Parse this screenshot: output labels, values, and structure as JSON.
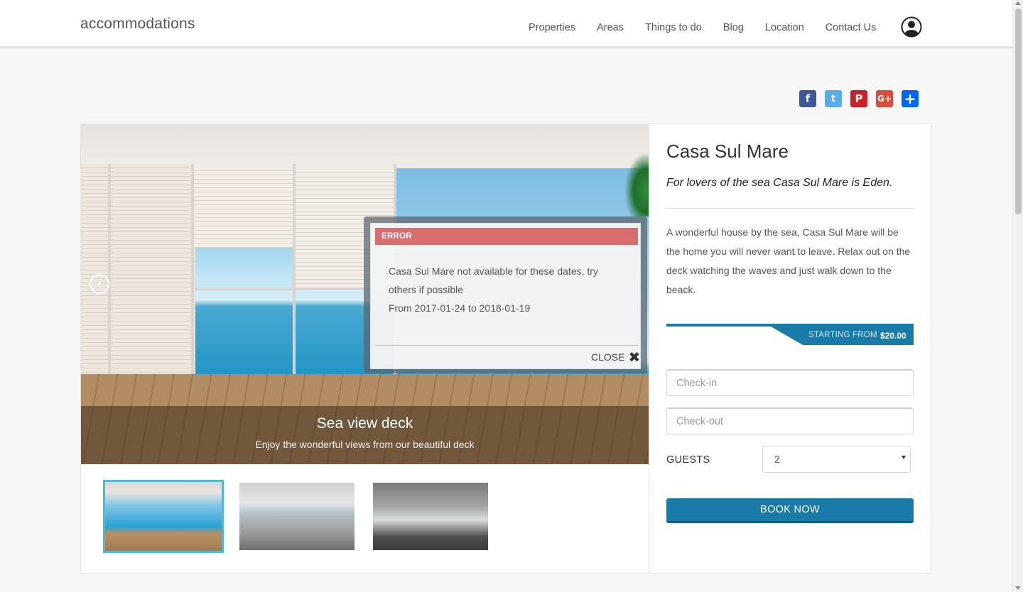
{
  "header": {
    "logo": "accommodations",
    "nav": [
      "Properties",
      "Areas",
      "Things to do",
      "Blog",
      "Location",
      "Contact Us"
    ],
    "user_icon": "user-circle-icon"
  },
  "share": {
    "icons": [
      "facebook-icon",
      "twitter-icon",
      "pinterest-icon",
      "google-plus-icon",
      "share-icon"
    ],
    "facebook": "f",
    "twitter": "t",
    "pinterest": "P",
    "google": "G+",
    "share": "+",
    "colors": {
      "facebook": "#3b5998",
      "twitter": "#55acee",
      "pinterest": "#cb2027",
      "google": "#dd4b39",
      "share": "#0166ff"
    }
  },
  "gallery": {
    "caption_title": "Sea view deck",
    "caption_subtitle": "Enjoy the wonderful views from our beautiful deck",
    "prev_arrow": "‹",
    "next_arrow": "›",
    "thumbnails": [
      "thumb-1",
      "thumb-2",
      "thumb-3"
    ],
    "active_thumbnail": 1
  },
  "error_modal": {
    "heading": "ERROR",
    "message": "Casa Sul Mare not available for these dates, try others if possible",
    "date_range": "From 2017-01-24 to 2018-01-19",
    "close_label": "CLOSE",
    "close_glyph": "✖"
  },
  "property": {
    "title": "Casa Sul Mare",
    "tagline": "For lovers of the sea Casa Sul Mare is Eden.",
    "description": "A wonderful house by the sea, Casa Sul Mare will be the home you will never want to leave. Relax out on the deck watching the waves and just walk down to the beack.",
    "price_label": "STARTING FROM",
    "price_value": "$20.00"
  },
  "booking": {
    "checkin_placeholder": "Check-in",
    "checkout_placeholder": "Check-out",
    "guests_label": "GUESTS",
    "guests_value": "2",
    "book_button": "BOOK NOW",
    "accent_color": "#1a7aa8"
  }
}
